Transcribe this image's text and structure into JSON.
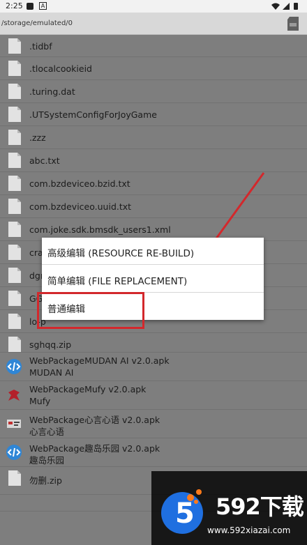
{
  "status_bar": {
    "time": "2:25",
    "notif_letter": "A"
  },
  "path": "/storage/emulated/0",
  "files": [
    {
      "name": ".tidbf",
      "icon": "file-icon"
    },
    {
      "name": ".tlocalcookieid",
      "icon": "file-icon"
    },
    {
      "name": ".turing.dat",
      "icon": "file-icon"
    },
    {
      "name": ".UTSystemConfigForJoyGame",
      "icon": "file-icon"
    },
    {
      "name": ".zzz",
      "icon": "file-icon"
    },
    {
      "name": "abc.txt",
      "icon": "file-icon"
    },
    {
      "name": "com.bzdeviceo.bzid.txt",
      "icon": "file-icon"
    },
    {
      "name": "com.bzdeviceo.uuid.txt",
      "icon": "file-icon"
    },
    {
      "name": "com.joke.sdk.bmsdk_users1.xml",
      "icon": "file-icon"
    },
    {
      "name": "cra",
      "icon": "file-icon"
    },
    {
      "name": "dgr",
      "icon": "file-icon"
    },
    {
      "name": "GG",
      "icon": "file-icon"
    },
    {
      "name": "lo-p",
      "icon": "file-icon"
    },
    {
      "name": "sghqq.zip",
      "icon": "file-icon"
    },
    {
      "name": "WebPackageMUDAN AI v2.0.apk",
      "sub": "MUDAN AI",
      "icon": "code-app-icon"
    },
    {
      "name": "WebPackageMufy v2.0.apk",
      "sub": "Mufy",
      "icon": "mufy-app-icon"
    },
    {
      "name": "WebPackage心言心语 v2.0.apk",
      "sub": "心言心语",
      "icon": "xinyan-app-icon"
    },
    {
      "name": "WebPackage趣岛乐园 v2.0.apk",
      "sub": "趣岛乐园",
      "icon": "code-app-icon"
    },
    {
      "name": "勿删.zip",
      "icon": "file-icon"
    }
  ],
  "menu": {
    "items": [
      "高级编辑 (RESOURCE RE-BUILD)",
      "简单编辑 (FILE REPLACEMENT)",
      "普通编辑"
    ]
  },
  "watermark": {
    "brand": "592下载",
    "url": "www.592xiazai.com"
  },
  "colors": {
    "highlight": "#d3282c",
    "overlay": "#7e7e7e"
  }
}
